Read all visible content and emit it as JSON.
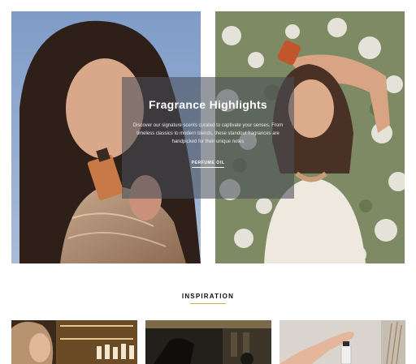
{
  "hero": {
    "left_image_alt": "Woman holding a perfume bottle near her face",
    "right_image_alt": "Woman holding a perfume bottle among white flowers",
    "overlay": {
      "title": "Fragrance Highlights",
      "description": "Discover our signature scents curated to captivate your senses. From timeless classics to modern blends, these standout fragrances are handpicked for their unique notes",
      "link_label": "PERFUME OIL"
    }
  },
  "inspiration": {
    "heading": "INSPIRATION",
    "accent_color": "#e2a35c",
    "items": [
      {
        "alt": "Woman in a fragrance boutique"
      },
      {
        "alt": "Dark boutique interior"
      },
      {
        "alt": "Hand picking up a perfume bottle"
      }
    ]
  }
}
